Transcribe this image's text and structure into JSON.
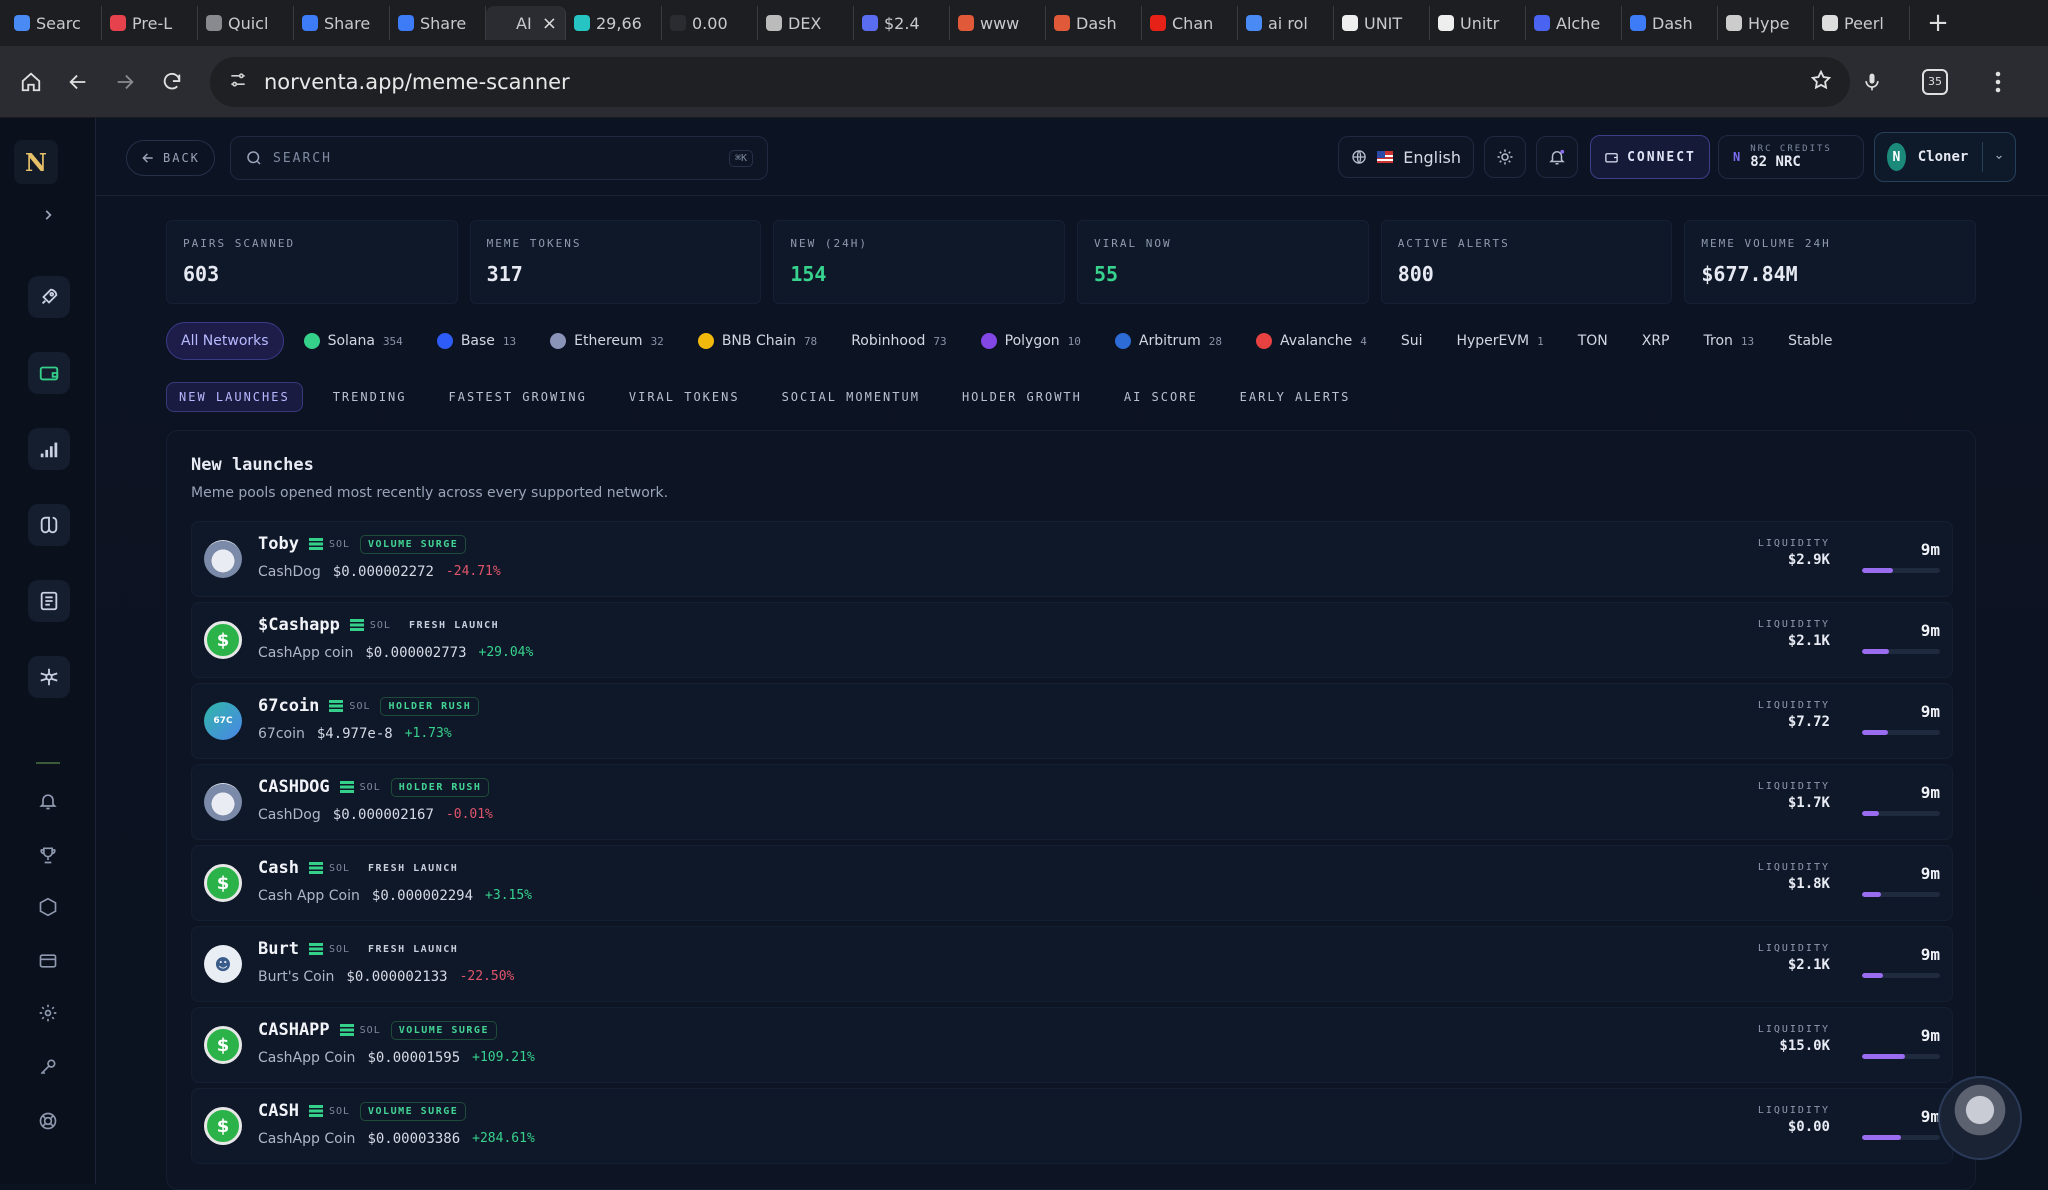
{
  "browser": {
    "tabs": [
      {
        "label": "Searc",
        "color": "#4a8af4"
      },
      {
        "label": "Pre-L",
        "color": "#e5424d"
      },
      {
        "label": "Quicl",
        "color": "#888a90"
      },
      {
        "label": "Share",
        "color": "#3d7bf7"
      },
      {
        "label": "Share",
        "color": "#3d7bf7"
      },
      {
        "label": "AI",
        "color": "#2b2c31",
        "active": true
      },
      {
        "label": "29,66",
        "color": "#27c4c4"
      },
      {
        "label": "0.00",
        "color": "#2b2c31"
      },
      {
        "label": "DEX",
        "color": "#bbbbbb"
      },
      {
        "label": "$2.4",
        "color": "#5a6cf0"
      },
      {
        "label": "www",
        "color": "#e05a3a"
      },
      {
        "label": "Dash",
        "color": "#e05a3a"
      },
      {
        "label": "Chan",
        "color": "#e62117"
      },
      {
        "label": "ai rol",
        "color": "#4a8af4"
      },
      {
        "label": "UNIT",
        "color": "#eeeeee"
      },
      {
        "label": "Unitr",
        "color": "#eeeeee"
      },
      {
        "label": "Alche",
        "color": "#4a63f0"
      },
      {
        "label": "Dash",
        "color": "#3d7bf7"
      },
      {
        "label": "Hype",
        "color": "#cccccc"
      },
      {
        "label": "Peerl",
        "color": "#dddddd"
      }
    ],
    "url": "norventa.app/meme-scanner",
    "extension_count": "35"
  },
  "topbar": {
    "back_label": "BACK",
    "search_placeholder": "SEARCH",
    "search_shortcut": "⌘K",
    "language": "English",
    "connect_label": "CONNECT",
    "credits_label": "NRC CREDITS",
    "credits_value": "82 NRC",
    "user_initial": "N",
    "user_name": "Cloner"
  },
  "stats": [
    {
      "label": "PAIRS SCANNED",
      "value": "603",
      "accent": false
    },
    {
      "label": "MEME TOKENS",
      "value": "317",
      "accent": false
    },
    {
      "label": "NEW (24H)",
      "value": "154",
      "accent": true
    },
    {
      "label": "VIRAL NOW",
      "value": "55",
      "accent": true
    },
    {
      "label": "ACTIVE ALERTS",
      "value": "800",
      "accent": false
    },
    {
      "label": "MEME VOLUME 24H",
      "value": "$677.84M",
      "accent": false
    }
  ],
  "networks": [
    {
      "name": "All Networks",
      "count": "",
      "active": true
    },
    {
      "name": "Solana",
      "count": "354",
      "color": "#35d08a"
    },
    {
      "name": "Base",
      "count": "13",
      "color": "#2d5cf6"
    },
    {
      "name": "Ethereum",
      "count": "32",
      "color": "#8a93b8"
    },
    {
      "name": "BNB Chain",
      "count": "78",
      "color": "#f0b90b"
    },
    {
      "name": "Robinhood",
      "count": "73"
    },
    {
      "name": "Polygon",
      "count": "10",
      "color": "#8247e5"
    },
    {
      "name": "Arbitrum",
      "count": "28",
      "color": "#2d6bd6"
    },
    {
      "name": "Avalanche",
      "count": "4",
      "color": "#e84142"
    },
    {
      "name": "Sui",
      "count": ""
    },
    {
      "name": "HyperEVM",
      "count": "1"
    },
    {
      "name": "TON",
      "count": ""
    },
    {
      "name": "XRP",
      "count": ""
    },
    {
      "name": "Tron",
      "count": "13"
    },
    {
      "name": "Stable",
      "count": ""
    }
  ],
  "filters": [
    {
      "label": "NEW LAUNCHES",
      "active": true
    },
    {
      "label": "TRENDING"
    },
    {
      "label": "FASTEST GROWING"
    },
    {
      "label": "VIRAL TOKENS"
    },
    {
      "label": "SOCIAL MOMENTUM"
    },
    {
      "label": "HOLDER GROWTH"
    },
    {
      "label": "AI SCORE"
    },
    {
      "label": "EARLY ALERTS"
    }
  ],
  "panel": {
    "title": "New launches",
    "subtitle": "Meme pools opened most recently across every supported network.",
    "liquidity_label": "LIQUIDITY"
  },
  "tokens": [
    {
      "symbol": "Toby",
      "chain": "SOL",
      "badge": "VOLUME SURGE",
      "badge_style": "outlined",
      "name": "CashDog",
      "price": "$0.000002272",
      "change": "-24.71%",
      "liquidity": "$2.9K",
      "age": "9m",
      "fill": 0.4,
      "icon": "dog"
    },
    {
      "symbol": "$Cashapp",
      "chain": "SOL",
      "badge": "FRESH LAUNCH",
      "badge_style": "plain",
      "name": "CashApp coin",
      "price": "$0.000002773",
      "change": "+29.04%",
      "liquidity": "$2.1K",
      "age": "9m",
      "fill": 0.35,
      "icon": "cash"
    },
    {
      "symbol": "67coin",
      "chain": "SOL",
      "badge": "HOLDER RUSH",
      "badge_style": "outlined",
      "name": "67coin",
      "price": "$4.977e-8",
      "change": "+1.73%",
      "liquidity": "$7.72",
      "age": "9m",
      "fill": 0.33,
      "icon": "sixt"
    },
    {
      "symbol": "CASHDOG",
      "chain": "SOL",
      "badge": "HOLDER RUSH",
      "badge_style": "outlined",
      "name": "CashDog",
      "price": "$0.000002167",
      "change": "-0.01%",
      "liquidity": "$1.7K",
      "age": "9m",
      "fill": 0.22,
      "icon": "dog"
    },
    {
      "symbol": "Cash",
      "chain": "SOL",
      "badge": "FRESH LAUNCH",
      "badge_style": "plain",
      "name": "Cash App Coin",
      "price": "$0.000002294",
      "change": "+3.15%",
      "liquidity": "$1.8K",
      "age": "9m",
      "fill": 0.24,
      "icon": "cash"
    },
    {
      "symbol": "Burt",
      "chain": "SOL",
      "badge": "FRESH LAUNCH",
      "badge_style": "plain",
      "name": "Burt's Coin",
      "price": "$0.000002133",
      "change": "-22.50%",
      "liquidity": "$2.1K",
      "age": "9m",
      "fill": 0.27,
      "icon": "burt"
    },
    {
      "symbol": "CASHAPP",
      "chain": "SOL",
      "badge": "VOLUME SURGE",
      "badge_style": "outlined",
      "name": "CashApp Coin",
      "price": "$0.00001595",
      "change": "+109.21%",
      "liquidity": "$15.0K",
      "age": "9m",
      "fill": 0.55,
      "icon": "cash"
    },
    {
      "symbol": "CASH",
      "chain": "SOL",
      "badge": "VOLUME SURGE",
      "badge_style": "outlined",
      "name": "CashApp Coin",
      "price": "$0.00003386",
      "change": "+284.61%",
      "liquidity": "$0.00",
      "age": "9m",
      "fill": 0.5,
      "icon": "cash"
    }
  ]
}
